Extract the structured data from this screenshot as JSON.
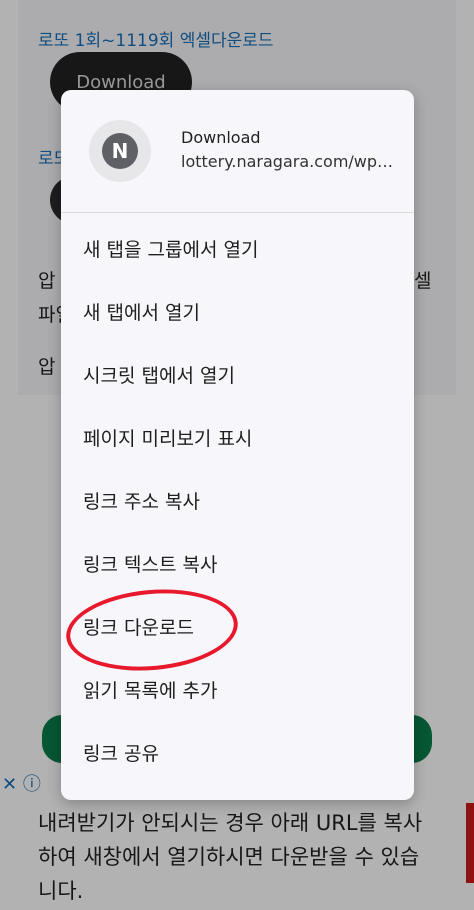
{
  "background": {
    "link1": "로또 1회~1119회 엑셀다운로드",
    "download_button": "Download",
    "link2": "로또",
    "text_frag_a": "압",
    "text_frag_b": "셀",
    "text_frag_c": "파일",
    "text_frag_d": "압",
    "ad_close": "✕",
    "ad_info": "ⓘ",
    "bottom_text": "내려받기가 안되시는 경우 아래 URL를 복사하여 새창에서 열기하시면 다운받을 수 있습니다."
  },
  "menu": {
    "favicon_letter": "N",
    "title": "Download",
    "url": "lottery.naragara.com/wp-c...",
    "items": [
      "새 탭을 그룹에서 열기",
      "새 탭에서 열기",
      "시크릿 탭에서 열기",
      "페이지 미리보기 표시",
      "링크 주소 복사",
      "링크 텍스트 복사",
      "링크 다운로드",
      "읽기 목록에 추가",
      "링크 공유"
    ]
  },
  "colors": {
    "annotation": "#e8192c",
    "link": "#1a6fb8",
    "button_green": "#0a7d4a"
  }
}
